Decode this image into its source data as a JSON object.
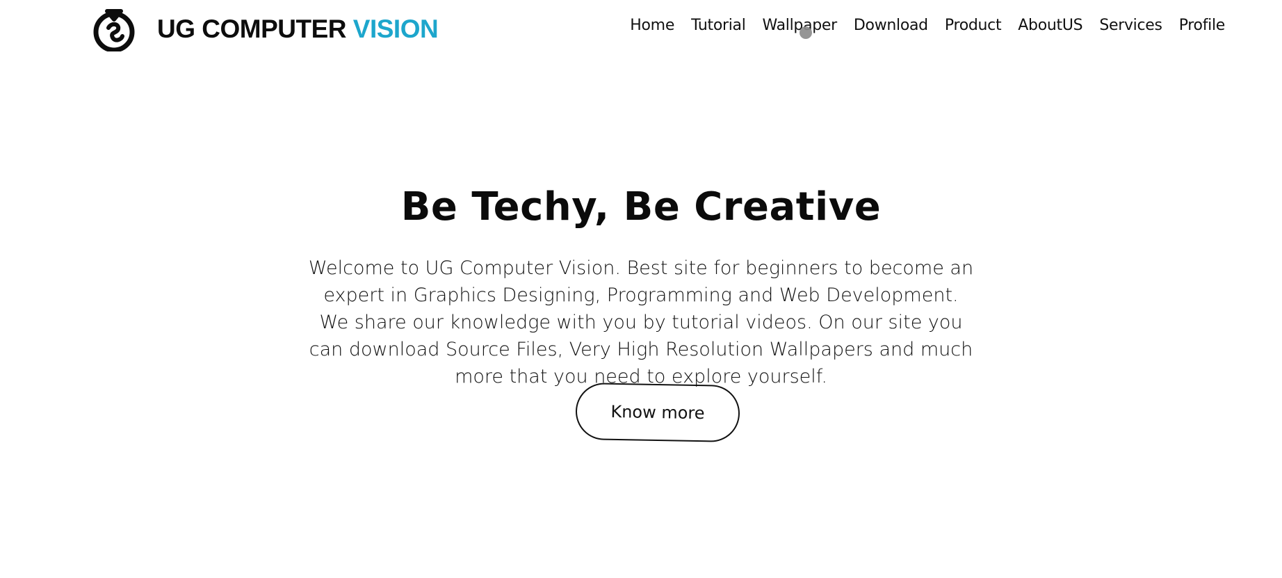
{
  "header": {
    "logo": {
      "icon": "ug-logo-mark-icon",
      "brand_dark": "UG COMPUTER",
      "brand_accent": "VISION"
    },
    "nav": [
      {
        "label": "Home"
      },
      {
        "label": "Tutorial"
      },
      {
        "label": "Wallpaper"
      },
      {
        "label": "Download"
      },
      {
        "label": "Product"
      },
      {
        "label": "AboutUS"
      },
      {
        "label": "Services"
      },
      {
        "label": "Profile"
      }
    ]
  },
  "hero": {
    "title": "Be Techy, Be Creative",
    "paragraph1": "Welcome to UG Computer Vision. Best site for beginners to become an expert in Graphics Designing, Programming and Web Development.",
    "paragraph2": "We share our knowledge with you by tutorial videos. On our site you can download Source Files, Very High Resolution Wallpapers and much more that you need to explore yourself.",
    "cta_label": "Know more"
  },
  "colors": {
    "accent": "#1da6cc",
    "text": "#111111",
    "background": "#ffffff"
  }
}
